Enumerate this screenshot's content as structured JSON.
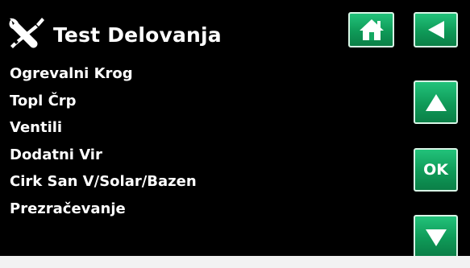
{
  "header": {
    "title": "Test Delovanja",
    "title_icon": "tools-icon"
  },
  "menu": {
    "items": [
      {
        "label": "Ogrevalni Krog"
      },
      {
        "label": "Topl Črp"
      },
      {
        "label": "Ventili"
      },
      {
        "label": "Dodatni Vir"
      },
      {
        "label": "Cirk San V/Solar/Bazen"
      },
      {
        "label": "Prezračevanje"
      }
    ]
  },
  "buttons": {
    "home": {
      "icon": "home-icon"
    },
    "back": {
      "icon": "back-arrow-icon"
    },
    "up": {
      "icon": "arrow-up-icon"
    },
    "ok": {
      "label": "OK"
    },
    "down": {
      "icon": "arrow-down-icon"
    }
  },
  "colors": {
    "background": "#000000",
    "text": "#ffffff",
    "button_green": "#14a862",
    "button_border": "#d8f5e6"
  }
}
